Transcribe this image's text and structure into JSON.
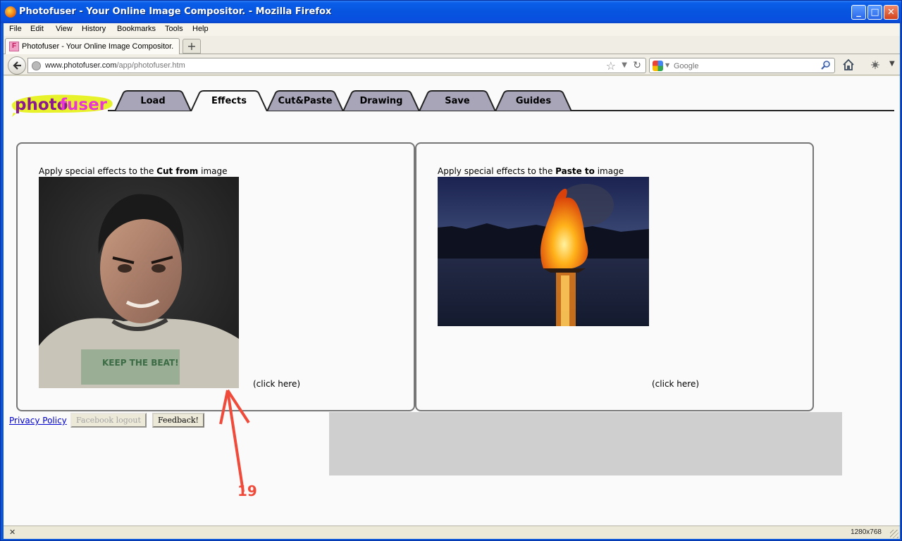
{
  "window": {
    "title": "Photofuser - Your Online Image Compositor. - Mozilla Firefox",
    "minimize": "_",
    "maximize": "□",
    "close": "✕"
  },
  "menu": [
    "File",
    "Edit",
    "View",
    "History",
    "Bookmarks",
    "Tools",
    "Help"
  ],
  "browser_tab": {
    "favicon_letter": "F",
    "label": "Photofuser - Your Online Image Compositor.",
    "new_tab": "+"
  },
  "navbar": {
    "url_domain": "www.photofuser.com",
    "url_path": "/app/photofuser.htm",
    "search_placeholder": "Google"
  },
  "app": {
    "logo_part1": "photo",
    "logo_part2": "fuser",
    "tabs": [
      "Load",
      "Effects",
      "Cut&Paste",
      "Drawing",
      "Save",
      "Guides"
    ],
    "active_tab": "Effects"
  },
  "panels": {
    "left": {
      "caption_prefix": "Apply special effects to the ",
      "caption_bold": "Cut from",
      "caption_suffix": " image",
      "click_here": "(click here)"
    },
    "right": {
      "caption_prefix": "Apply special effects to the ",
      "caption_bold": "Paste to",
      "caption_suffix": " image",
      "click_here": "(click here)"
    }
  },
  "footer": {
    "privacy": "Privacy Policy",
    "facebook_logout": "Facebook logout",
    "feedback": "Feedback!"
  },
  "annotation": {
    "number": "19",
    "color": "#f04a3a"
  },
  "statusbar": {
    "close": "✕",
    "resolution": "1280x768"
  },
  "colors": {
    "titlebar": "#0754df",
    "tab_fill": "#a8a5b8",
    "logo_yellow": "#e8f22a",
    "logo_purple": "#8b1a8b",
    "logo_pink": "#e935d6"
  }
}
